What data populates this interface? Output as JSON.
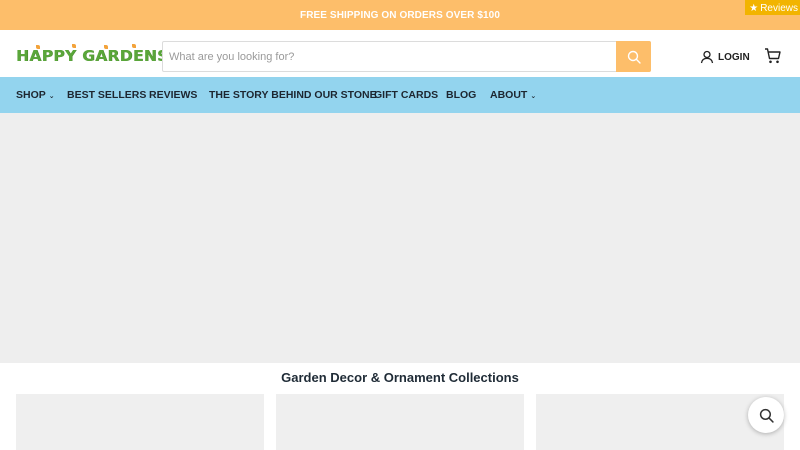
{
  "announcement": {
    "text": "FREE SHIPPING ON ORDERS OVER $100"
  },
  "reviews_tab": {
    "star": "★",
    "label": "Reviews"
  },
  "header": {
    "logo_text": "HAPPY GARDENS",
    "search": {
      "placeholder": "What are you looking for?",
      "value": ""
    },
    "search_icon": "search-icon",
    "login_label": "LOGIN",
    "user_icon": "user-icon",
    "cart_icon": "cart-icon"
  },
  "nav": {
    "items": [
      {
        "label": "SHOP",
        "dropdown": true
      },
      {
        "label": "BEST SELLERS",
        "dropdown": false
      },
      {
        "label": "REVIEWS",
        "dropdown": false
      },
      {
        "label": "THE STORY BEHIND OUR STONE",
        "dropdown": false
      },
      {
        "label": "GIFT CARDS",
        "dropdown": false
      },
      {
        "label": "BLOG",
        "dropdown": false
      },
      {
        "label": "ABOUT",
        "dropdown": true
      }
    ],
    "chevron": "⌄"
  },
  "main": {
    "section_title": "Garden Decor & Ornament Collections"
  },
  "colors": {
    "announcement_bg": "#fdbe6a",
    "nav_bg": "#93d4ee",
    "logo_green": "#5aa63a",
    "reviews_badge": "#f2b400",
    "hero_placeholder": "#eeeeee"
  }
}
